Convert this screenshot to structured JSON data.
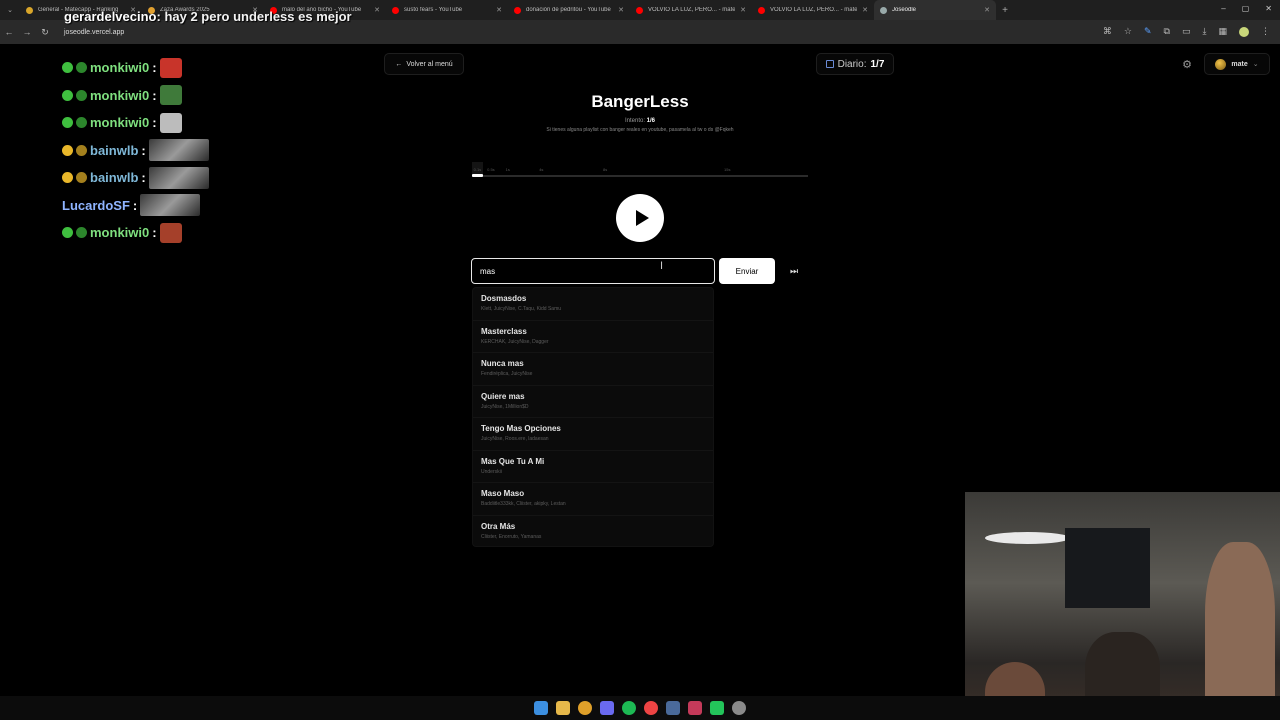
{
  "browser": {
    "tabs": [
      {
        "title": "General - Matecapp - Ranking",
        "color": "#d9a62a"
      },
      {
        "title": "Zaza Awards 2025",
        "color": "#e0a030"
      },
      {
        "title": "malo del año bicho - YouTube",
        "color": "#ff0000"
      },
      {
        "title": "susto fears - YouTube",
        "color": "#ff0000"
      },
      {
        "title": "donación de pedritou - YouTube",
        "color": "#ff0000"
      },
      {
        "title": "VOLVIO LA LUZ, PERO... - mate",
        "color": "#ff0000"
      },
      {
        "title": "VOLVIO LA LUZ, PERO... - mate",
        "color": "#ff0000"
      },
      {
        "title": "Joseodle",
        "color": "#9aa"
      }
    ],
    "url": "joseodle.vercel.app"
  },
  "header": {
    "back_label": "Volver al menú",
    "daily_label": "Diario:",
    "daily_value": "1/7",
    "user_name": "mate"
  },
  "game": {
    "title": "BangerLess",
    "attempt_label": "Intento:",
    "attempt_value": "1/6",
    "hint": "Si tienes alguna playlist con banger reales en youtube, pasamela al tw o ds @Fqkeh",
    "progress": {
      "segments": [
        {
          "label": "0.1s",
          "pos": 0.005
        },
        {
          "label": "0.5s",
          "pos": 0.045
        },
        {
          "label": "1s",
          "pos": 0.1
        },
        {
          "label": "4s",
          "pos": 0.2
        },
        {
          "label": "8s",
          "pos": 0.39
        },
        {
          "label": "15s",
          "pos": 0.75
        }
      ],
      "played_fraction": 0.033
    },
    "input_value": "mas",
    "send_label": "Enviar"
  },
  "suggestions": [
    {
      "title": "Dosmasdos",
      "artists": "Klett, JuicyNise, C.Taqu, Kidd Samu"
    },
    {
      "title": "Masterclass",
      "artists": "KERCHAK, JuicyNise, Dagger"
    },
    {
      "title": "Nunca mas",
      "artists": "Fendiréplica, JuicyNise"
    },
    {
      "title": "Quiere mas",
      "artists": "JuicyNise, 1Million$D"
    },
    {
      "title": "Tengo Mas Opciones",
      "artists": "JuicyNise, Roos.ere, ladaesan"
    },
    {
      "title": "Mas Que Tu A Mi",
      "artists": "Underskii"
    },
    {
      "title": "Maso Maso",
      "artists": "Baddiitle333kk, Cliister, akipky, Lestan"
    },
    {
      "title": "Otra Más",
      "artists": "Cliister, Enorruto, Yamanas"
    }
  ],
  "chat": {
    "top_message": {
      "user": "gerardelvecino",
      "text": "hay 2 pero underless es mejor"
    },
    "messages": [
      {
        "user": "monkiwi0",
        "name_color": "#7fe07f",
        "badge": "green",
        "emote_color": "#c8342a"
      },
      {
        "user": "monkiwi0",
        "name_color": "#7fe07f",
        "badge": "green",
        "emote_color": "#3f7a3a"
      },
      {
        "user": "monkiwi0",
        "name_color": "#7fe07f",
        "badge": "green",
        "emote_color": "#bcbcbc"
      },
      {
        "user": "bainwlb",
        "name_color": "#7fb8d8",
        "badge": "yellow",
        "emote_color": "wide"
      },
      {
        "user": "bainwlb",
        "name_color": "#7fb8d8",
        "badge": "yellow",
        "emote_color": "wide"
      },
      {
        "user": "LucardoSF",
        "name_color": "#8fb4ff",
        "badge": "none",
        "emote_color": "wide"
      },
      {
        "user": "monkiwi0",
        "name_color": "#7fe07f",
        "badge": "green",
        "emote_color": "#a5402a"
      }
    ]
  }
}
